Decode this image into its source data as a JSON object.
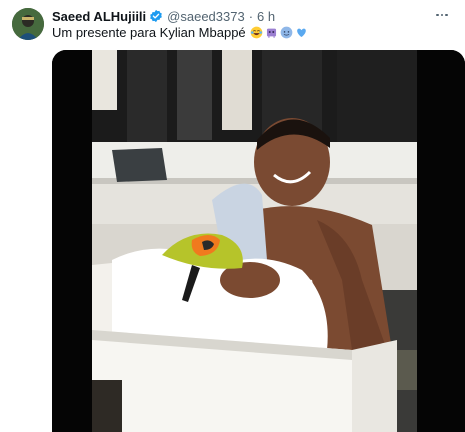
{
  "tweet": {
    "author_name": "Saeed ALHujiili",
    "handle": "@saeed3373",
    "separator": "·",
    "time": "6 h",
    "text": "Um presente para Kylian Mbappé",
    "emojis": [
      "laughing-crying-emoji",
      "alien-monster-emoji",
      "sweat-emoji",
      "blue-heart-emoji"
    ]
  },
  "colors": {
    "verified": "#1d9bf0",
    "secondary_text": "#536471",
    "primary_text": "#0f1419",
    "heart": "#5aa9f0"
  },
  "media": {
    "type": "video",
    "description_icon": "video-thumbnail"
  }
}
